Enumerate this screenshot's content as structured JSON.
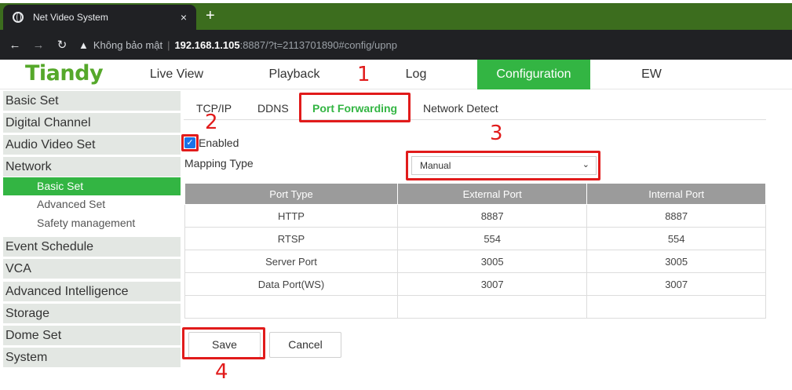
{
  "browser": {
    "tab_title": "Net Video System",
    "tab_close": "×",
    "new_tab": "+",
    "security_label": "Không bảo mật",
    "separator": "|",
    "url_host": "192.168.1.105",
    "url_rest": ":8887/?t=2113701890#config/upnp"
  },
  "header": {
    "logo": "Tiandy",
    "nav": [
      "Live View",
      "Playback",
      "Log",
      "Configuration",
      "EW"
    ],
    "active_nav": "Configuration"
  },
  "sidebar": {
    "items": [
      "Basic Set",
      "Digital Channel",
      "Audio Video Set",
      "Network"
    ],
    "network_sub": [
      "Basic Set",
      "Advanced Set",
      "Safety management"
    ],
    "items_after": [
      "Event Schedule",
      "VCA",
      "Advanced Intelligence",
      "Storage",
      "Dome Set",
      "System"
    ]
  },
  "subtabs": [
    "TCP/IP",
    "DDNS",
    "Port Forwarding",
    "Network Detect"
  ],
  "form": {
    "enabled_label": "Enabled",
    "enabled_checked": true,
    "mapping_label": "Mapping Type",
    "mapping_value": "Manual"
  },
  "table": {
    "headers": [
      "Port Type",
      "External Port",
      "Internal Port"
    ],
    "rows": [
      [
        "HTTP",
        "8887",
        "8887"
      ],
      [
        "RTSP",
        "554",
        "554"
      ],
      [
        "Server Port",
        "3005",
        "3005"
      ],
      [
        "Data Port(WS)",
        "3007",
        "3007"
      ],
      [
        "",
        "",
        ""
      ]
    ]
  },
  "buttons": {
    "save": "Save",
    "cancel": "Cancel"
  },
  "annotations": [
    "1",
    "2",
    "3",
    "4"
  ],
  "colors": {
    "accent": "#33b543",
    "annotation": "#e11b1b",
    "tab_bar": "#3c6d1e"
  }
}
